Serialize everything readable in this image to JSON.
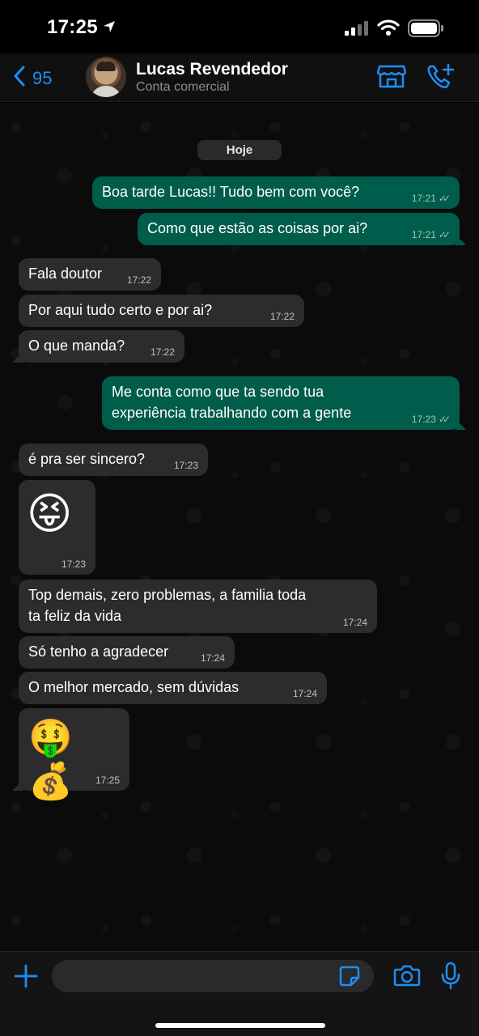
{
  "status_bar": {
    "time": "17:25"
  },
  "header": {
    "back_count": "95",
    "contact_name": "Lucas Revendedor",
    "contact_subtitle": "Conta comercial"
  },
  "chat": {
    "date_label": "Hoje",
    "messages": [
      {
        "dir": "out",
        "text": "Boa tarde Lucas!! Tudo bem com você?",
        "time": "17:21"
      },
      {
        "dir": "out",
        "text": "Como que estão as coisas por ai?",
        "time": "17:21"
      },
      {
        "dir": "in",
        "text": "Fala doutor",
        "time": "17:22"
      },
      {
        "dir": "in",
        "text": "Por aqui tudo certo e por ai?",
        "time": "17:22"
      },
      {
        "dir": "in",
        "text": "O que manda?",
        "time": "17:22"
      },
      {
        "dir": "out",
        "text": "Me conta como que ta sendo tua experiência trabalhando com a gente",
        "time": "17:23"
      },
      {
        "dir": "in",
        "text": "é pra ser sincero?",
        "time": "17:23"
      },
      {
        "dir": "in",
        "text": "😝",
        "time": "17:23"
      },
      {
        "dir": "in",
        "text": "Top demais, zero problemas, a familia toda ta feliz da vida",
        "time": "17:24"
      },
      {
        "dir": "in",
        "text": "Só tenho a agradecer",
        "time": "17:24"
      },
      {
        "dir": "in",
        "text": "O melhor mercado, sem dúvidas",
        "time": "17:24"
      },
      {
        "dir": "in",
        "text": "🤑 💰",
        "time": "17:25"
      }
    ]
  },
  "composer": {
    "placeholder": ""
  },
  "colors": {
    "accent": "#1d8ef6",
    "outgoing_bubble": "#005c4b",
    "incoming_bubble": "#2c2c2e",
    "background": "#000000"
  },
  "icons": [
    "location-arrow-icon",
    "signal-icon",
    "wifi-icon",
    "battery-icon",
    "chevron-left-icon",
    "store-icon",
    "phone-plus-icon",
    "plus-icon",
    "sticker-icon",
    "camera-icon",
    "mic-icon",
    "double-check-icon"
  ]
}
